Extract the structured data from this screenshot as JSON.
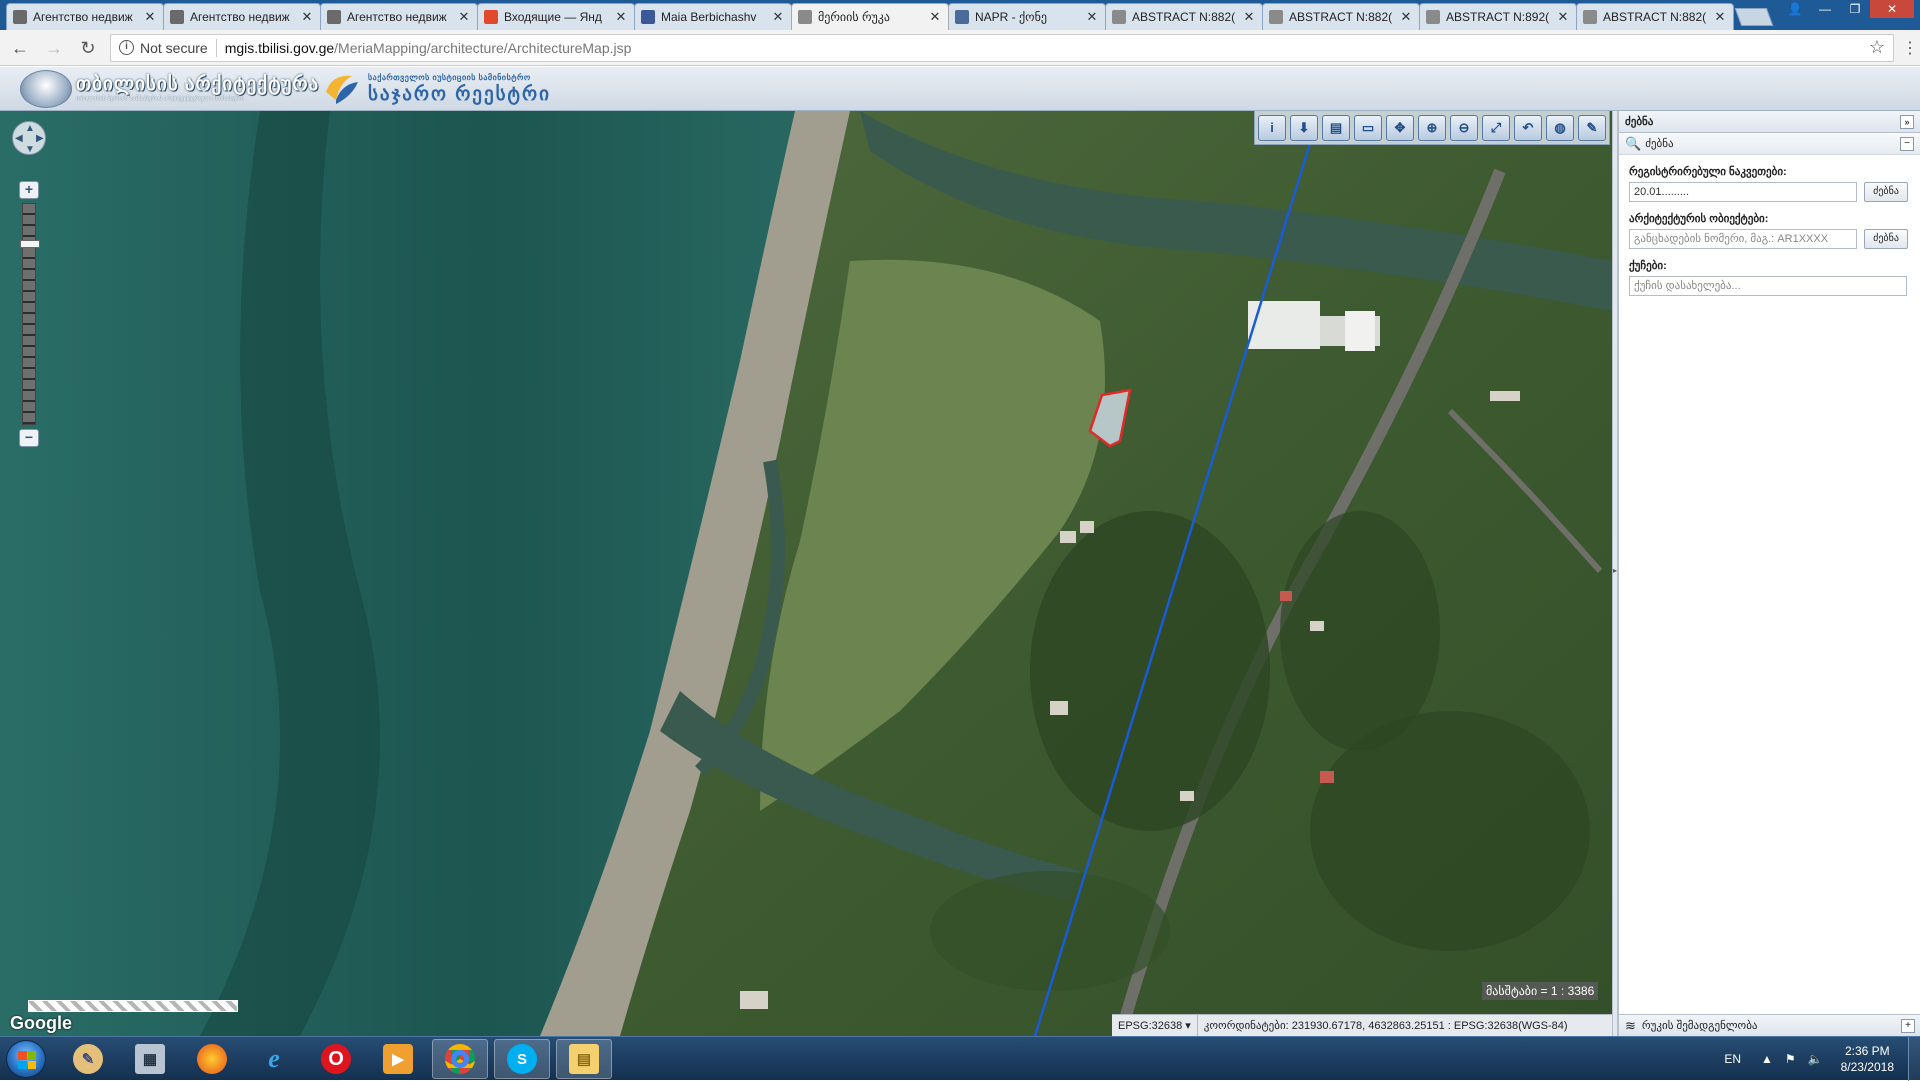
{
  "browser": {
    "tabs": [
      {
        "title": "Агентство недвиж",
        "favicon": "person-favicon",
        "color": "#6a6a6a"
      },
      {
        "title": "Агентство недвиж",
        "favicon": "person-favicon",
        "color": "#6a6a6a"
      },
      {
        "title": "Агентство недвиж",
        "favicon": "person-favicon",
        "color": "#6a6a6a"
      },
      {
        "title": "Входящие — Янд",
        "favicon": "mail-favicon",
        "color": "#e0492c"
      },
      {
        "title": "Maia Berbichashv",
        "favicon": "facebook-favicon",
        "color": "#3b5998"
      },
      {
        "title": "მერიის რუკა",
        "favicon": "globe-favicon",
        "color": "#8a8a8a"
      },
      {
        "title": "NAPR - ქონე",
        "favicon": "napr-favicon",
        "color": "#4a6a9a"
      },
      {
        "title": "ABSTRACT N:882(",
        "favicon": "document-favicon",
        "color": "#8a8a8a"
      },
      {
        "title": "ABSTRACT N:882(",
        "favicon": "document-favicon",
        "color": "#8a8a8a"
      },
      {
        "title": "ABSTRACT N:892(",
        "favicon": "document-favicon",
        "color": "#8a8a8a"
      },
      {
        "title": "ABSTRACT N:882(",
        "favicon": "document-favicon",
        "color": "#8a8a8a"
      }
    ],
    "active_tab_index": 5,
    "address": {
      "security": "Not secure",
      "host": "mgis.tbilisi.gov.ge",
      "path": "/MeriaMapping/architecture/ArchitectureMap.jsp"
    }
  },
  "header": {
    "logo1_title": "თბილისის არქიტექტურა",
    "logo1_subtitle": "თბილისის მერიის სამსახურის არქიტექტურული სამსახური",
    "logo2_top": "საქართველოს იუსტიციის სამინისტრო",
    "logo2_title": "საჯარო რეესტრი"
  },
  "map": {
    "tools": [
      "info-icon",
      "identify-icon",
      "layers-table-icon",
      "measure-icon",
      "pan-icon",
      "zoom-in-icon",
      "zoom-out-icon",
      "zoom-extent-icon",
      "zoom-previous-icon",
      "globe-icon",
      "edit-icon"
    ],
    "scale_label": "მასშტაბი = 1 : 3386",
    "google_label": "Google",
    "epsg": "EPSG:32638",
    "coordinates": "კოორდინატები: 231930.67178, 4632863.25151 : EPSG:32638(WGS-84)"
  },
  "panel": {
    "title": "ძებნა",
    "section": "ძებნა",
    "cadastral_label": "რეგისტრირებული ნაკვეთები:",
    "cadastral_value": "20.01.........",
    "cadastral_button": "ძებნა",
    "architecture_label": "არქიტექტურის ობიექტები:",
    "architecture_placeholder": "განცხადების ნომერი, მაგ.: AR1XXXX",
    "architecture_button": "ძებნა",
    "street_label": "ქუჩები:",
    "street_placeholder": "ქუჩის დასახელება...",
    "footer": "რუკის შემადგენლობა"
  },
  "taskbar": {
    "apps": [
      "start-button",
      "paint-icon",
      "calculator-icon",
      "firefox-icon",
      "ie-icon",
      "opera-icon",
      "media-player-icon",
      "chrome-icon",
      "skype-icon",
      "file-explorer-icon"
    ],
    "lang": "EN",
    "time": "2:36 PM",
    "date": "8/23/2018"
  }
}
